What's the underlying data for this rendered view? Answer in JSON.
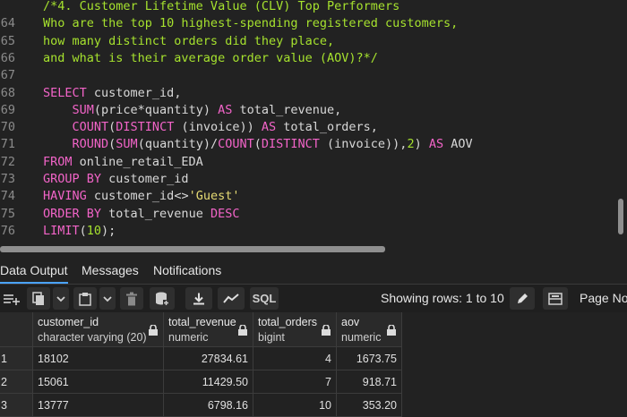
{
  "editor": {
    "lines": [
      {
        "n": "",
        "tokens": [
          {
            "t": "/*4. Customer Lifetime Value (CLV) Top Performers",
            "c": "comment"
          }
        ]
      },
      {
        "n": "64",
        "tokens": [
          {
            "t": "Who are the top 10 highest-spending registered customers,",
            "c": "comment"
          }
        ]
      },
      {
        "n": "65",
        "tokens": [
          {
            "t": "how many distinct orders did they place,",
            "c": "comment"
          }
        ]
      },
      {
        "n": "66",
        "tokens": [
          {
            "t": "and what is their average order value (AOV)?*/",
            "c": "comment"
          }
        ]
      },
      {
        "n": "67",
        "tokens": []
      },
      {
        "n": "68",
        "tokens": [
          {
            "t": "SELECT",
            "c": "kw"
          },
          {
            "t": " customer_id,",
            "c": "op"
          }
        ]
      },
      {
        "n": "69",
        "tokens": [
          {
            "t": "    ",
            "c": "op"
          },
          {
            "t": "SUM",
            "c": "kw"
          },
          {
            "t": "(price*quantity) ",
            "c": "op"
          },
          {
            "t": "AS",
            "c": "kw"
          },
          {
            "t": " total_revenue,",
            "c": "op"
          }
        ]
      },
      {
        "n": "70",
        "tokens": [
          {
            "t": "    ",
            "c": "op"
          },
          {
            "t": "COUNT",
            "c": "kw"
          },
          {
            "t": "(",
            "c": "op"
          },
          {
            "t": "DISTINCT",
            "c": "kw"
          },
          {
            "t": " (invoice)) ",
            "c": "op"
          },
          {
            "t": "AS",
            "c": "kw"
          },
          {
            "t": " total_orders,",
            "c": "op"
          }
        ]
      },
      {
        "n": "71",
        "tokens": [
          {
            "t": "    ",
            "c": "op"
          },
          {
            "t": "ROUND",
            "c": "kw"
          },
          {
            "t": "(",
            "c": "op"
          },
          {
            "t": "SUM",
            "c": "kw"
          },
          {
            "t": "(quantity)/",
            "c": "op"
          },
          {
            "t": "COUNT",
            "c": "kw"
          },
          {
            "t": "(",
            "c": "op"
          },
          {
            "t": "DISTINCT",
            "c": "kw"
          },
          {
            "t": " (invoice)),",
            "c": "op"
          },
          {
            "t": "2",
            "c": "num"
          },
          {
            "t": ") ",
            "c": "op"
          },
          {
            "t": "AS",
            "c": "kw"
          },
          {
            "t": " AOV",
            "c": "op"
          }
        ]
      },
      {
        "n": "72",
        "tokens": [
          {
            "t": "FROM",
            "c": "kw"
          },
          {
            "t": " online_retail_EDA",
            "c": "op"
          }
        ]
      },
      {
        "n": "73",
        "tokens": [
          {
            "t": "GROUP BY",
            "c": "kw"
          },
          {
            "t": " customer_id",
            "c": "op"
          }
        ]
      },
      {
        "n": "74",
        "tokens": [
          {
            "t": "HAVING",
            "c": "kw"
          },
          {
            "t": " customer_id<>",
            "c": "op"
          },
          {
            "t": "'Guest'",
            "c": "str"
          }
        ]
      },
      {
        "n": "75",
        "tokens": [
          {
            "t": "ORDER BY",
            "c": "kw"
          },
          {
            "t": " total_revenue ",
            "c": "op"
          },
          {
            "t": "DESC",
            "c": "kw"
          }
        ]
      },
      {
        "n": "76",
        "tokens": [
          {
            "t": "LIMIT",
            "c": "kw"
          },
          {
            "t": "(",
            "c": "op"
          },
          {
            "t": "10",
            "c": "num"
          },
          {
            "t": ");",
            "c": "op"
          }
        ]
      }
    ]
  },
  "tabs": [
    {
      "label": "Data Output",
      "active": true
    },
    {
      "label": "Messages",
      "active": false
    },
    {
      "label": "Notifications",
      "active": false
    }
  ],
  "toolbar": {
    "sql_label": "SQL",
    "showing_rows": "Showing rows: 1 to 10",
    "page_no": "Page No"
  },
  "grid": {
    "columns": [
      {
        "name": "customer_id",
        "type": "character varying (20)"
      },
      {
        "name": "total_revenue",
        "type": "numeric"
      },
      {
        "name": "total_orders",
        "type": "bigint"
      },
      {
        "name": "aov",
        "type": "numeric"
      }
    ],
    "rows": [
      {
        "num": "1",
        "cells": [
          "18102",
          "27834.61",
          "4",
          "1673.75"
        ]
      },
      {
        "num": "2",
        "cells": [
          "15061",
          "11429.50",
          "7",
          "918.71"
        ]
      },
      {
        "num": "3",
        "cells": [
          "13777",
          "6798.16",
          "10",
          "353.20"
        ]
      }
    ]
  },
  "colors": {
    "comment": "#a6e22e",
    "keyword": "#f264c8",
    "string": "#e6db74",
    "accent": "#4aa3ff",
    "background": "#222222"
  }
}
